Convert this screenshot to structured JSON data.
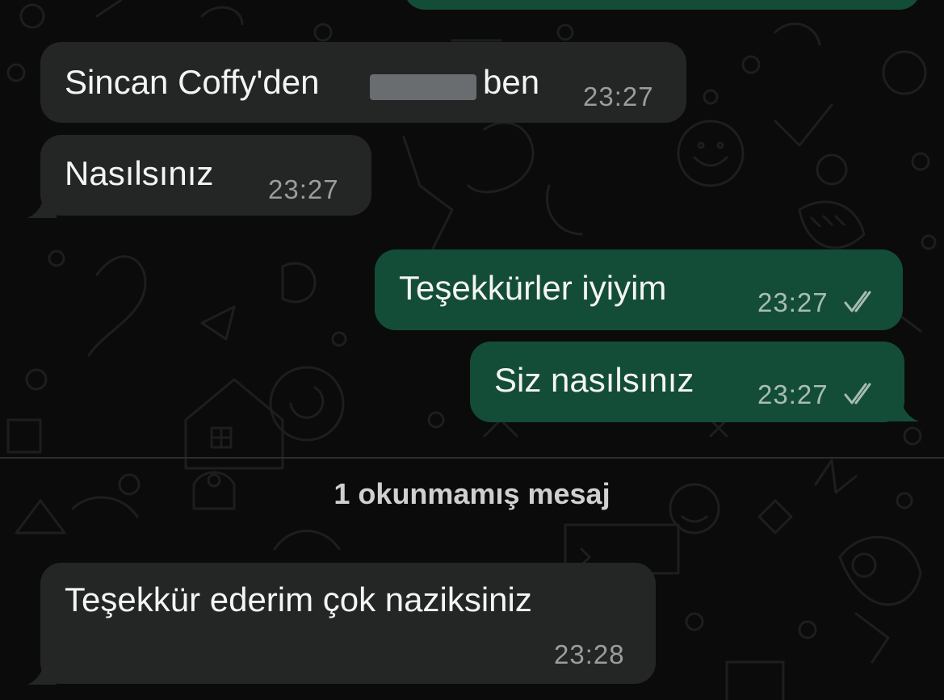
{
  "messages": [
    {
      "direction": "incoming",
      "text_before": "Sincan Coffy'den",
      "text_after": "ben",
      "redacted": true,
      "time": "23:27"
    },
    {
      "direction": "incoming",
      "text": "Nasılsınız",
      "time": "23:27"
    },
    {
      "direction": "outgoing",
      "text": "Teşekkürler iyiyim",
      "time": "23:27",
      "status": "read-double-check"
    },
    {
      "direction": "outgoing",
      "text": "Siz nasılsınız",
      "time": "23:27",
      "status": "read-double-check"
    },
    {
      "direction": "incoming",
      "text": "Teşekkür ederim çok naziksiniz",
      "time": "23:28"
    }
  ],
  "unread_divider": {
    "label": "1 okunmamış mesaj"
  },
  "colors": {
    "background": "#0b0b0b",
    "incoming_bubble": "#242626",
    "outgoing_bubble": "#144d37",
    "text": "#f4f4f4",
    "timestamp": "#9a9d9c"
  },
  "icons": {
    "read_receipt": "double-check-icon"
  }
}
